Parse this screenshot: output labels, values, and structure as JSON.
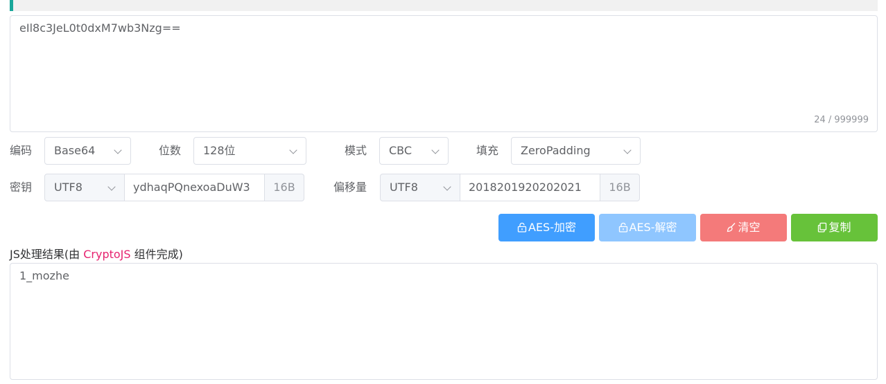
{
  "input": {
    "value": "eIl8c3JeL0t0dxM7wb3Nzg==",
    "counter": "24 / 999999"
  },
  "options": {
    "encoding_label": "编码",
    "encoding_value": "Base64",
    "bits_label": "位数",
    "bits_value": "128位",
    "mode_label": "模式",
    "mode_value": "CBC",
    "padding_label": "填充",
    "padding_value": "ZeroPadding"
  },
  "key": {
    "label": "密钥",
    "charset": "UTF8",
    "value": "ydhaqPQnexoaDuW3",
    "size": "16B"
  },
  "iv": {
    "label": "偏移量",
    "charset": "UTF8",
    "value": "2018201920202021",
    "size": "16B"
  },
  "buttons": {
    "encrypt": "AES-加密",
    "decrypt": "AES-解密",
    "clear": "清空",
    "copy": "复制"
  },
  "colors": {
    "encrypt": "#409eff",
    "decrypt": "#8fc6ff",
    "clear": "#f47a7a",
    "copy": "#67c23a"
  },
  "result": {
    "label_prefix": "JS处理结果(由 ",
    "label_lib": "CryptoJS",
    "label_suffix": " 组件完成)",
    "value": "1_mozhe"
  }
}
